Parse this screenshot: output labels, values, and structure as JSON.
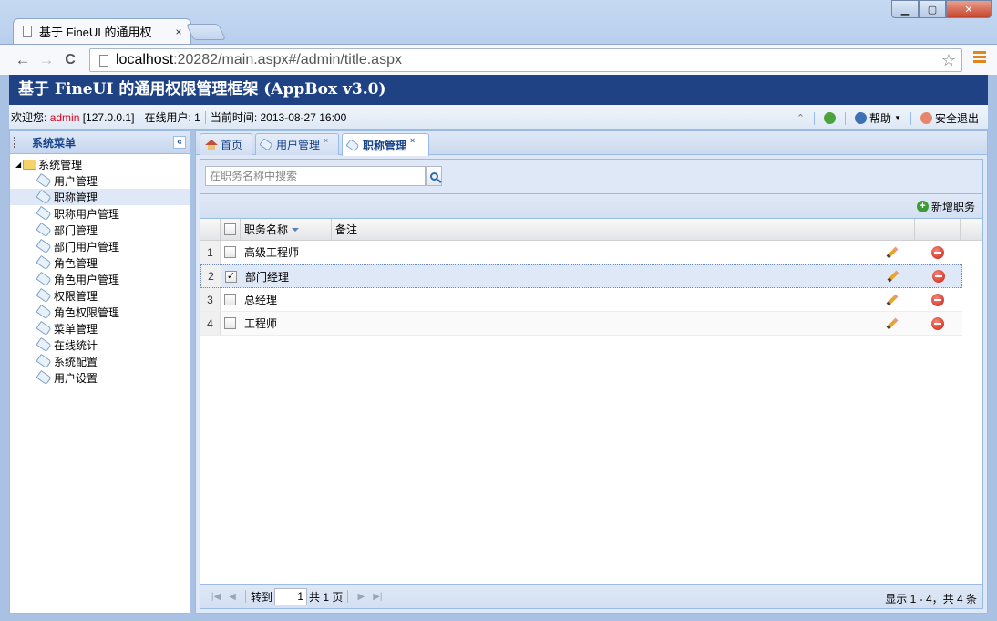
{
  "browser": {
    "tab_title": "基于 FineUI 的通用权",
    "tab_close": "×",
    "url_host": "localhost",
    "url_rest": ":20282/main.aspx#/admin/title.aspx",
    "back": "←",
    "forward": "→",
    "reload": "C",
    "star": "☆",
    "win_min": "▁",
    "win_max": "▢",
    "win_close": "✕"
  },
  "app": {
    "title": "基于 FineUI 的通用权限管理框架 (AppBox v3.0)"
  },
  "infobar": {
    "welcome_label": "欢迎您:",
    "user": "admin",
    "ip": "[127.0.0.1]",
    "online_label": "在线用户:",
    "online_count": "1",
    "time_label": "当前时间:",
    "time": "2013-08-27 16:00",
    "help": "帮助",
    "logout": "安全退出"
  },
  "sidebar": {
    "title": "系统菜单",
    "collapse": "«",
    "root": "系统管理",
    "items": [
      {
        "label": "用户管理"
      },
      {
        "label": "职称管理"
      },
      {
        "label": "职称用户管理"
      },
      {
        "label": "部门管理"
      },
      {
        "label": "部门用户管理"
      },
      {
        "label": "角色管理"
      },
      {
        "label": "角色用户管理"
      },
      {
        "label": "权限管理"
      },
      {
        "label": "角色权限管理"
      },
      {
        "label": "菜单管理"
      },
      {
        "label": "在线统计"
      },
      {
        "label": "系统配置"
      },
      {
        "label": "用户设置"
      }
    ],
    "selected": "职称管理"
  },
  "main": {
    "tabs": [
      {
        "label": "首页"
      },
      {
        "label": "用户管理",
        "close": "×"
      },
      {
        "label": "职称管理",
        "close": "×"
      }
    ],
    "search_placeholder": "在职务名称中搜索",
    "add_button": "新增职务",
    "grid": {
      "columns": [
        "职务名称",
        "备注"
      ],
      "rows": [
        {
          "num": "1",
          "name": "高级工程师",
          "note": "",
          "checked": ""
        },
        {
          "num": "2",
          "name": "部门经理",
          "note": "",
          "checked": "✓"
        },
        {
          "num": "3",
          "name": "总经理",
          "note": "",
          "checked": ""
        },
        {
          "num": "4",
          "name": "工程师",
          "note": "",
          "checked": ""
        }
      ]
    },
    "pager": {
      "goto_label": "转到",
      "page": "1",
      "total_pages_label": "共 1 页",
      "info": "显示 1 - 4，共 4 条"
    }
  }
}
